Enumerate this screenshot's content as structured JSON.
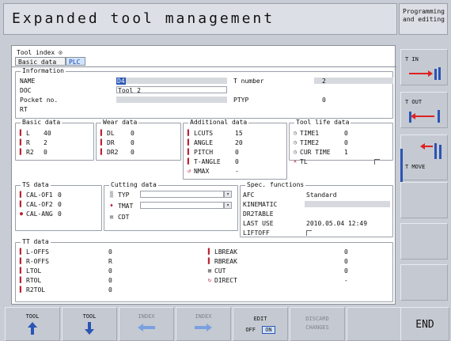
{
  "header": {
    "title": "Expanded tool management",
    "mode_line1": "Programming",
    "mode_line2": "and editing"
  },
  "tool_index": {
    "label": "Tool index",
    "marker": "⊙"
  },
  "tabs": [
    {
      "label": "Basic data"
    },
    {
      "label": "PLC"
    }
  ],
  "information": {
    "legend": "Information",
    "name_label": "NAME",
    "name_value": "D4",
    "tnum_label": "T number",
    "tnum_value": "2",
    "doc_label": "DOC",
    "doc_value": "Tool 2",
    "pocket_label": "Pocket no.",
    "ptyp_label": "PTYP",
    "ptyp_value": "0",
    "rt_label": "RT"
  },
  "basic_data": {
    "legend": "Basic data",
    "rows": [
      {
        "label": "L",
        "value": "40"
      },
      {
        "label": "R",
        "value": "2"
      },
      {
        "label": "R2",
        "value": "0"
      }
    ]
  },
  "wear_data": {
    "legend": "Wear data",
    "rows": [
      {
        "label": "DL",
        "value": "0"
      },
      {
        "label": "DR",
        "value": "0"
      },
      {
        "label": "DR2",
        "value": "0"
      }
    ]
  },
  "additional_data": {
    "legend": "Additional data",
    "rows": [
      {
        "label": "LCUTS",
        "value": "15"
      },
      {
        "label": "ANGLE",
        "value": "20"
      },
      {
        "label": "PITCH",
        "value": "0"
      },
      {
        "label": "T-ANGLE",
        "value": "0"
      },
      {
        "label": "NMAX",
        "value": "-"
      }
    ]
  },
  "tool_life": {
    "legend": "Tool life data",
    "rows": [
      {
        "label": "TIME1",
        "value": "0"
      },
      {
        "label": "TIME2",
        "value": "0"
      },
      {
        "label": "CUR TIME",
        "value": "1"
      },
      {
        "label": "TL",
        "value": ""
      }
    ]
  },
  "ts_data": {
    "legend": "TS data",
    "rows": [
      {
        "label": "CAL-OF1",
        "value": "0"
      },
      {
        "label": "CAL-OF2",
        "value": "0"
      },
      {
        "label": "CAL-ANG",
        "value": "0"
      }
    ]
  },
  "cutting_data": {
    "legend": "Cutting data",
    "typ_label": "TYP",
    "tmat_label": "TMAT",
    "cdt_label": "CDT"
  },
  "spec_functions": {
    "legend": "Spec. functions",
    "rows": [
      {
        "label": "AFC",
        "value": "Standard"
      },
      {
        "label": "KINEMATIC",
        "value": ""
      },
      {
        "label": "DR2TABLE",
        "value": ""
      },
      {
        "label": "LAST USE",
        "value": "2010.05.04 12:49"
      },
      {
        "label": "LIFTOFF",
        "value": ""
      }
    ]
  },
  "tt_data": {
    "legend": "TT data",
    "left": [
      {
        "label": "L-OFFS",
        "value": "0"
      },
      {
        "label": "R-OFFS",
        "value": "R"
      },
      {
        "label": "LTOL",
        "value": "0"
      },
      {
        "label": "RTOL",
        "value": "0"
      },
      {
        "label": "R2TOL",
        "value": "0"
      }
    ],
    "right": [
      {
        "label": "LBREAK",
        "value": "0"
      },
      {
        "label": "RBREAK",
        "value": "0"
      },
      {
        "label": "CUT",
        "value": "0"
      },
      {
        "label": "DIRECT",
        "value": "-"
      }
    ]
  },
  "right_softkeys": [
    {
      "label": "T IN"
    },
    {
      "label": "T OUT"
    },
    {
      "label": "T MOVE"
    }
  ],
  "bottom_softkeys": {
    "tool_up": "TOOL",
    "tool_down": "TOOL",
    "index_back": "INDEX",
    "index_fwd": "INDEX",
    "edit_title": "EDIT",
    "edit_off": "OFF",
    "edit_on": "ON",
    "discard_line1": "DISCARD",
    "discard_line2": "CHANGES",
    "end": "END"
  },
  "colors": {
    "accent": "#2a55b5",
    "panel": "#ffffff",
    "chrome": "#c8ccd4"
  }
}
